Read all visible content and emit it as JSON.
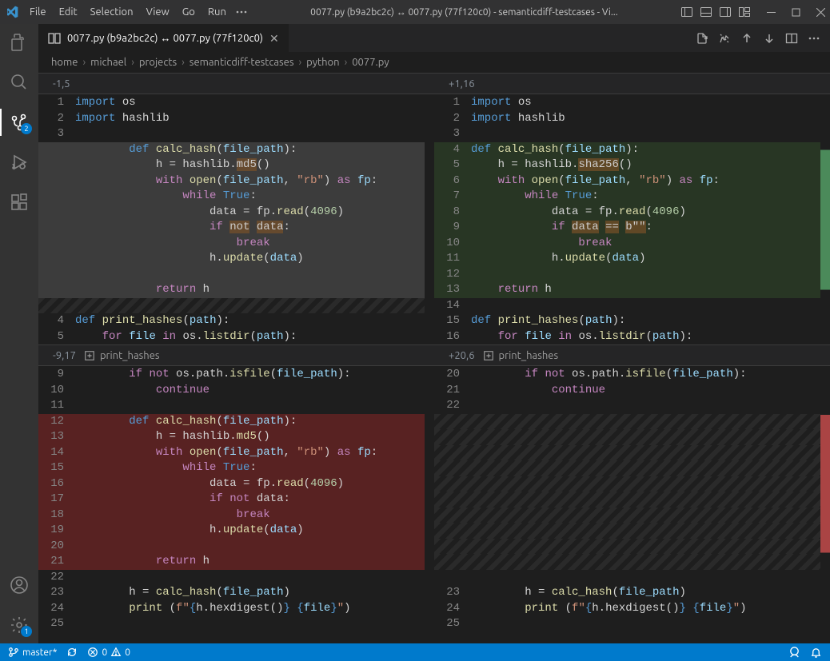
{
  "title": "0077.py (b9a2bc2c) ↔ 0077.py (77f120c0) - semanticdiff-testcases - Vi...",
  "menus": [
    "File",
    "Edit",
    "Selection",
    "View",
    "Go",
    "Run"
  ],
  "tab": {
    "label": "0077.py (b9a2bc2c) ↔ 0077.py (77f120c0)"
  },
  "breadcrumbs": [
    "home",
    "michael",
    "projects",
    "semanticdiff-testcases",
    "python",
    "0077.py"
  ],
  "hunk1": {
    "left": "-1,5",
    "right": "+1,16"
  },
  "hunk2": {
    "left": "-9,17",
    "right": "+20,6",
    "context_left": "print_hashes",
    "context_right": "print_hashes"
  },
  "activity_badges": {
    "scm": "2",
    "settings": "1"
  },
  "status": {
    "branch": "master*",
    "errors": "0",
    "warnings": "0"
  },
  "left1": [
    {
      "n": "1",
      "seg": [
        [
          "kw",
          "import"
        ],
        [
          "plain",
          " os"
        ]
      ]
    },
    {
      "n": "2",
      "seg": [
        [
          "kw",
          "import"
        ],
        [
          "plain",
          " hashlib"
        ]
      ]
    },
    {
      "n": "3",
      "seg": []
    },
    {
      "n": "",
      "cls": "move-src",
      "seg": [
        [
          "pad",
          "        "
        ],
        [
          "kw",
          "def"
        ],
        [
          "plain",
          " "
        ],
        [
          "fn",
          "calc_hash"
        ],
        [
          "plain",
          "("
        ],
        [
          "var",
          "file_path"
        ],
        [
          "plain",
          "):"
        ]
      ]
    },
    {
      "n": "",
      "cls": "move-src",
      "seg": [
        [
          "pad",
          "            "
        ],
        [
          "plain",
          "h = hashlib."
        ],
        [
          "inline",
          "md5"
        ],
        [
          "plain",
          "()"
        ]
      ]
    },
    {
      "n": "",
      "cls": "move-src",
      "seg": [
        [
          "pad",
          "            "
        ],
        [
          "kwflow",
          "with"
        ],
        [
          "plain",
          " "
        ],
        [
          "fn",
          "open"
        ],
        [
          "plain",
          "("
        ],
        [
          "var",
          "file_path"
        ],
        [
          "plain",
          ", "
        ],
        [
          "str",
          "\"rb\""
        ],
        [
          "plain",
          ") "
        ],
        [
          "kwflow",
          "as"
        ],
        [
          "plain",
          " "
        ],
        [
          "var",
          "fp"
        ],
        [
          "plain",
          ":"
        ]
      ]
    },
    {
      "n": "",
      "cls": "move-src",
      "seg": [
        [
          "pad",
          "                "
        ],
        [
          "kwflow",
          "while"
        ],
        [
          "plain",
          " "
        ],
        [
          "const",
          "True"
        ],
        [
          "plain",
          ":"
        ]
      ]
    },
    {
      "n": "",
      "cls": "move-src",
      "seg": [
        [
          "pad",
          "                    "
        ],
        [
          "plain",
          "data = fp."
        ],
        [
          "fn",
          "read"
        ],
        [
          "plain",
          "("
        ],
        [
          "num",
          "4096"
        ],
        [
          "plain",
          ")"
        ]
      ]
    },
    {
      "n": "",
      "cls": "move-src",
      "seg": [
        [
          "pad",
          "                    "
        ],
        [
          "kwflow",
          "if"
        ],
        [
          "plain",
          " "
        ],
        [
          "inline",
          "not"
        ],
        [
          "plain",
          " "
        ],
        [
          "inline",
          "data"
        ],
        [
          "plain",
          ":"
        ]
      ]
    },
    {
      "n": "",
      "cls": "move-src",
      "seg": [
        [
          "pad",
          "                        "
        ],
        [
          "kwflow",
          "break"
        ]
      ]
    },
    {
      "n": "",
      "cls": "move-src",
      "seg": [
        [
          "pad",
          "                    "
        ],
        [
          "plain",
          "h."
        ],
        [
          "fn",
          "update"
        ],
        [
          "plain",
          "("
        ],
        [
          "var",
          "data"
        ],
        [
          "plain",
          ")"
        ]
      ]
    },
    {
      "n": "",
      "cls": "move-src",
      "seg": []
    },
    {
      "n": "",
      "cls": "move-src",
      "seg": [
        [
          "pad",
          "            "
        ],
        [
          "kwflow",
          "return"
        ],
        [
          "plain",
          " h"
        ]
      ]
    },
    {
      "n": "",
      "cls": "shadow",
      "seg": []
    },
    {
      "n": "4",
      "seg": [
        [
          "kw",
          "def"
        ],
        [
          "plain",
          " "
        ],
        [
          "fn",
          "print_hashes"
        ],
        [
          "plain",
          "("
        ],
        [
          "var",
          "path"
        ],
        [
          "plain",
          "):"
        ]
      ]
    },
    {
      "n": "5",
      "seg": [
        [
          "pad",
          "    "
        ],
        [
          "kwflow",
          "for"
        ],
        [
          "plain",
          " "
        ],
        [
          "var",
          "file"
        ],
        [
          "plain",
          " "
        ],
        [
          "kwflow",
          "in"
        ],
        [
          "plain",
          " os."
        ],
        [
          "fn",
          "listdir"
        ],
        [
          "plain",
          "("
        ],
        [
          "var",
          "path"
        ],
        [
          "plain",
          "):"
        ]
      ]
    }
  ],
  "right1": [
    {
      "n": "1",
      "seg": [
        [
          "kw",
          "import"
        ],
        [
          "plain",
          " os"
        ]
      ]
    },
    {
      "n": "2",
      "seg": [
        [
          "kw",
          "import"
        ],
        [
          "plain",
          " hashlib"
        ]
      ]
    },
    {
      "n": "3",
      "seg": []
    },
    {
      "n": "4",
      "cls": "ins",
      "seg": [
        [
          "kw",
          "def"
        ],
        [
          "plain",
          " "
        ],
        [
          "fn",
          "calc_hash"
        ],
        [
          "plain",
          "("
        ],
        [
          "var",
          "file_path"
        ],
        [
          "plain",
          "):"
        ]
      ]
    },
    {
      "n": "5",
      "cls": "ins",
      "seg": [
        [
          "pad",
          "    "
        ],
        [
          "plain",
          "h = hashlib."
        ],
        [
          "inline",
          "sha256"
        ],
        [
          "plain",
          "()"
        ]
      ]
    },
    {
      "n": "6",
      "cls": "ins",
      "seg": [
        [
          "pad",
          "    "
        ],
        [
          "kwflow",
          "with"
        ],
        [
          "plain",
          " "
        ],
        [
          "fn",
          "open"
        ],
        [
          "plain",
          "("
        ],
        [
          "var",
          "file_path"
        ],
        [
          "plain",
          ", "
        ],
        [
          "str",
          "\"rb\""
        ],
        [
          "plain",
          ") "
        ],
        [
          "kwflow",
          "as"
        ],
        [
          "plain",
          " "
        ],
        [
          "var",
          "fp"
        ],
        [
          "plain",
          ":"
        ]
      ]
    },
    {
      "n": "7",
      "cls": "ins",
      "seg": [
        [
          "pad",
          "        "
        ],
        [
          "kwflow",
          "while"
        ],
        [
          "plain",
          " "
        ],
        [
          "const",
          "True"
        ],
        [
          "plain",
          ":"
        ]
      ]
    },
    {
      "n": "8",
      "cls": "ins",
      "seg": [
        [
          "pad",
          "            "
        ],
        [
          "plain",
          "data = fp."
        ],
        [
          "fn",
          "read"
        ],
        [
          "plain",
          "("
        ],
        [
          "num",
          "4096"
        ],
        [
          "plain",
          ")"
        ]
      ]
    },
    {
      "n": "9",
      "cls": "ins",
      "seg": [
        [
          "pad",
          "            "
        ],
        [
          "kwflow",
          "if"
        ],
        [
          "plain",
          " "
        ],
        [
          "inline",
          "data"
        ],
        [
          "plain",
          " "
        ],
        [
          "inline",
          "=="
        ],
        [
          "plain",
          " "
        ],
        [
          "inline",
          "b"
        ],
        [
          "inline",
          "\"\""
        ],
        [
          "plain",
          ":"
        ]
      ]
    },
    {
      "n": "10",
      "cls": "ins",
      "seg": [
        [
          "pad",
          "                "
        ],
        [
          "kwflow",
          "break"
        ]
      ]
    },
    {
      "n": "11",
      "cls": "ins",
      "seg": [
        [
          "pad",
          "            "
        ],
        [
          "plain",
          "h."
        ],
        [
          "fn",
          "update"
        ],
        [
          "plain",
          "("
        ],
        [
          "var",
          "data"
        ],
        [
          "plain",
          ")"
        ]
      ]
    },
    {
      "n": "12",
      "cls": "ins",
      "seg": []
    },
    {
      "n": "13",
      "cls": "ins",
      "seg": [
        [
          "pad",
          "    "
        ],
        [
          "kwflow",
          "return"
        ],
        [
          "plain",
          " h"
        ]
      ]
    },
    {
      "n": "14",
      "seg": []
    },
    {
      "n": "15",
      "seg": [
        [
          "kw",
          "def"
        ],
        [
          "plain",
          " "
        ],
        [
          "fn",
          "print_hashes"
        ],
        [
          "plain",
          "("
        ],
        [
          "var",
          "path"
        ],
        [
          "plain",
          "):"
        ]
      ]
    },
    {
      "n": "16",
      "seg": [
        [
          "pad",
          "    "
        ],
        [
          "kwflow",
          "for"
        ],
        [
          "plain",
          " "
        ],
        [
          "var",
          "file"
        ],
        [
          "plain",
          " "
        ],
        [
          "kwflow",
          "in"
        ],
        [
          "plain",
          " os."
        ],
        [
          "fn",
          "listdir"
        ],
        [
          "plain",
          "("
        ],
        [
          "var",
          "path"
        ],
        [
          "plain",
          "):"
        ]
      ]
    }
  ],
  "left2": [
    {
      "n": "9",
      "seg": [
        [
          "pad",
          "        "
        ],
        [
          "kwflow",
          "if"
        ],
        [
          "plain",
          " "
        ],
        [
          "kwflow",
          "not"
        ],
        [
          "plain",
          " os.path."
        ],
        [
          "fn",
          "isfile"
        ],
        [
          "plain",
          "("
        ],
        [
          "var",
          "file_path"
        ],
        [
          "plain",
          "):"
        ]
      ]
    },
    {
      "n": "10",
      "seg": [
        [
          "pad",
          "            "
        ],
        [
          "kwflow",
          "continue"
        ]
      ]
    },
    {
      "n": "11",
      "seg": []
    },
    {
      "n": "12",
      "cls": "del",
      "seg": [
        [
          "pad",
          "        "
        ],
        [
          "kw",
          "def"
        ],
        [
          "plain",
          " "
        ],
        [
          "fn",
          "calc_hash"
        ],
        [
          "plain",
          "("
        ],
        [
          "var",
          "file_path"
        ],
        [
          "plain",
          "):"
        ]
      ]
    },
    {
      "n": "13",
      "cls": "del",
      "seg": [
        [
          "pad",
          "            "
        ],
        [
          "plain",
          "h = hashlib."
        ],
        [
          "fn",
          "md5"
        ],
        [
          "plain",
          "()"
        ]
      ]
    },
    {
      "n": "14",
      "cls": "del",
      "seg": [
        [
          "pad",
          "            "
        ],
        [
          "kwflow",
          "with"
        ],
        [
          "plain",
          " "
        ],
        [
          "fn",
          "open"
        ],
        [
          "plain",
          "("
        ],
        [
          "var",
          "file_path"
        ],
        [
          "plain",
          ", "
        ],
        [
          "str",
          "\"rb\""
        ],
        [
          "plain",
          ") "
        ],
        [
          "kwflow",
          "as"
        ],
        [
          "plain",
          " "
        ],
        [
          "var",
          "fp"
        ],
        [
          "plain",
          ":"
        ]
      ]
    },
    {
      "n": "15",
      "cls": "del",
      "seg": [
        [
          "pad",
          "                "
        ],
        [
          "kwflow",
          "while"
        ],
        [
          "plain",
          " "
        ],
        [
          "const",
          "True"
        ],
        [
          "plain",
          ":"
        ]
      ]
    },
    {
      "n": "16",
      "cls": "del",
      "seg": [
        [
          "pad",
          "                    "
        ],
        [
          "plain",
          "data = fp."
        ],
        [
          "fn",
          "read"
        ],
        [
          "plain",
          "("
        ],
        [
          "num",
          "4096"
        ],
        [
          "plain",
          ")"
        ]
      ]
    },
    {
      "n": "17",
      "cls": "del",
      "seg": [
        [
          "pad",
          "                    "
        ],
        [
          "kwflow",
          "if"
        ],
        [
          "plain",
          " "
        ],
        [
          "kwflow",
          "not"
        ],
        [
          "plain",
          " data:"
        ]
      ]
    },
    {
      "n": "18",
      "cls": "del",
      "seg": [
        [
          "pad",
          "                        "
        ],
        [
          "kwflow",
          "break"
        ]
      ]
    },
    {
      "n": "19",
      "cls": "del",
      "seg": [
        [
          "pad",
          "                    "
        ],
        [
          "plain",
          "h."
        ],
        [
          "fn",
          "update"
        ],
        [
          "plain",
          "("
        ],
        [
          "var",
          "data"
        ],
        [
          "plain",
          ")"
        ]
      ]
    },
    {
      "n": "20",
      "cls": "del",
      "seg": []
    },
    {
      "n": "21",
      "cls": "del",
      "seg": [
        [
          "pad",
          "            "
        ],
        [
          "kwflow",
          "return"
        ],
        [
          "plain",
          " h"
        ]
      ]
    },
    {
      "n": "22",
      "seg": []
    },
    {
      "n": "23",
      "seg": [
        [
          "pad",
          "        "
        ],
        [
          "plain",
          "h = "
        ],
        [
          "fn",
          "calc_hash"
        ],
        [
          "plain",
          "("
        ],
        [
          "var",
          "file_path"
        ],
        [
          "plain",
          ")"
        ]
      ]
    },
    {
      "n": "24",
      "seg": [
        [
          "pad",
          "        "
        ],
        [
          "fn",
          "print"
        ],
        [
          "plain",
          " ("
        ],
        [
          "str",
          "f\""
        ],
        [
          "const",
          "{"
        ],
        [
          "plain",
          "h.hexdigest()"
        ],
        [
          "const",
          "}"
        ],
        [
          "str",
          " "
        ],
        [
          "const",
          "{"
        ],
        [
          "var",
          "file"
        ],
        [
          "const",
          "}"
        ],
        [
          "str",
          "\""
        ],
        [
          "plain",
          ")"
        ]
      ]
    },
    {
      "n": "25",
      "seg": []
    }
  ],
  "right2": [
    {
      "n": "20",
      "seg": [
        [
          "pad",
          "        "
        ],
        [
          "kwflow",
          "if"
        ],
        [
          "plain",
          " "
        ],
        [
          "kwflow",
          "not"
        ],
        [
          "plain",
          " os.path."
        ],
        [
          "fn",
          "isfile"
        ],
        [
          "plain",
          "("
        ],
        [
          "var",
          "file_path"
        ],
        [
          "plain",
          "):"
        ]
      ]
    },
    {
      "n": "21",
      "seg": [
        [
          "pad",
          "            "
        ],
        [
          "kwflow",
          "continue"
        ]
      ]
    },
    {
      "n": "22",
      "seg": []
    },
    {
      "n": "",
      "cls": "shadow",
      "seg": []
    },
    {
      "n": "",
      "cls": "shadow",
      "seg": []
    },
    {
      "n": "",
      "cls": "shadow",
      "seg": []
    },
    {
      "n": "",
      "cls": "shadow",
      "seg": []
    },
    {
      "n": "",
      "cls": "shadow",
      "seg": []
    },
    {
      "n": "",
      "cls": "shadow",
      "seg": []
    },
    {
      "n": "",
      "cls": "shadow",
      "seg": []
    },
    {
      "n": "",
      "cls": "shadow",
      "seg": []
    },
    {
      "n": "",
      "cls": "shadow",
      "seg": []
    },
    {
      "n": "",
      "cls": "shadow",
      "seg": []
    },
    {
      "n": "",
      "seg": []
    },
    {
      "n": "23",
      "seg": [
        [
          "pad",
          "        "
        ],
        [
          "plain",
          "h = "
        ],
        [
          "fn",
          "calc_hash"
        ],
        [
          "plain",
          "("
        ],
        [
          "var",
          "file_path"
        ],
        [
          "plain",
          ")"
        ]
      ]
    },
    {
      "n": "24",
      "seg": [
        [
          "pad",
          "        "
        ],
        [
          "fn",
          "print"
        ],
        [
          "plain",
          " ("
        ],
        [
          "str",
          "f\""
        ],
        [
          "const",
          "{"
        ],
        [
          "plain",
          "h.hexdigest()"
        ],
        [
          "const",
          "}"
        ],
        [
          "str",
          " "
        ],
        [
          "const",
          "{"
        ],
        [
          "var",
          "file"
        ],
        [
          "const",
          "}"
        ],
        [
          "str",
          "\""
        ],
        [
          "plain",
          ")"
        ]
      ]
    },
    {
      "n": "25",
      "seg": []
    }
  ]
}
